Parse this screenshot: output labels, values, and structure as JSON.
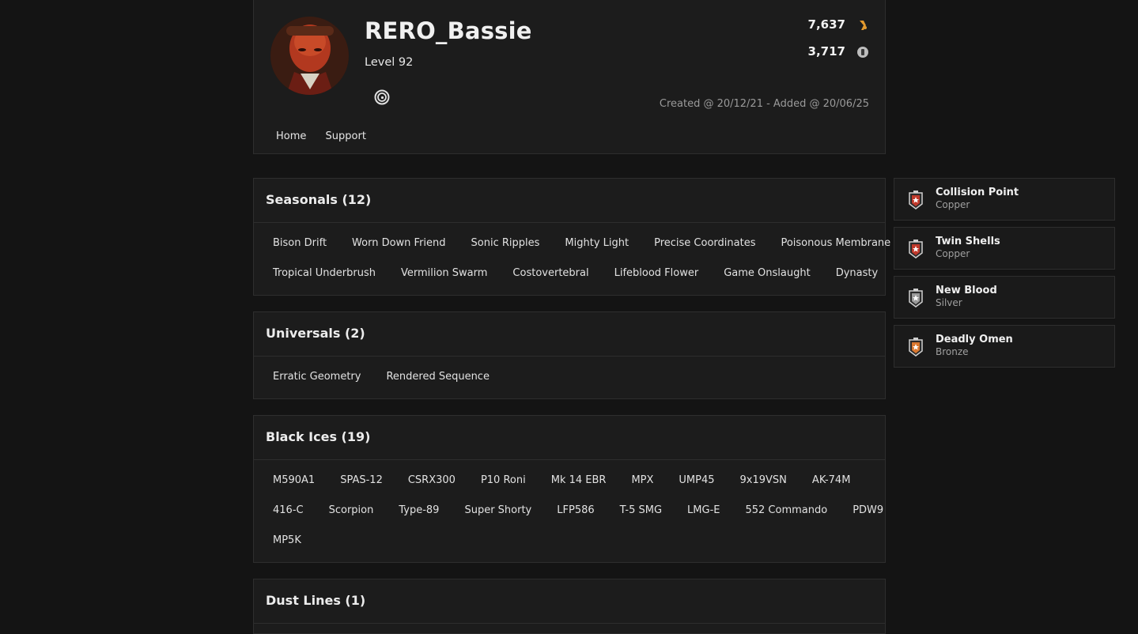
{
  "profile": {
    "username": "RERO_Bassie",
    "level": "Level 92",
    "stat1": "7,637",
    "stat2": "3,717",
    "dates": "Created @ 20/12/21 - Added @ 20/06/25",
    "nav": [
      "Home",
      "Support"
    ]
  },
  "sections": {
    "seasonals": {
      "title": "Seasonals (12)",
      "row1": [
        "Bison Drift",
        "Worn Down Friend",
        "Sonic Ripples",
        "Mighty Light",
        "Precise Coordinates",
        "Poisonous Membrane"
      ],
      "row2": [
        "Tropical Underbrush",
        "Vermilion Swarm",
        "Costovertebral",
        "Lifeblood Flower",
        "Game Onslaught",
        "Dynasty"
      ]
    },
    "universals": {
      "title": "Universals (2)",
      "row1": [
        "Erratic Geometry",
        "Rendered Sequence"
      ]
    },
    "blackices": {
      "title": "Black Ices (19)",
      "row1": [
        "M590A1",
        "SPAS-12",
        "CSRX300",
        "P10 Roni",
        "Mk 14 EBR",
        "MPX",
        "UMP45",
        "9x19VSN",
        "AK-74M"
      ],
      "row2": [
        "416-C",
        "Scorpion",
        "Type-89",
        "Super Shorty",
        "LFP586",
        "T-5 SMG",
        "LMG-E",
        "552 Commando",
        "PDW9"
      ],
      "row3": [
        "MP5K"
      ]
    },
    "dustlines": {
      "title": "Dust Lines (1)"
    }
  },
  "cards": [
    {
      "name": "Collision Point",
      "tier": "Copper",
      "color": "#c0392b"
    },
    {
      "name": "Twin Shells",
      "tier": "Copper",
      "color": "#c0392b"
    },
    {
      "name": "New Blood",
      "tier": "Silver",
      "color": "#9a9a9a"
    },
    {
      "name": "Deadly Omen",
      "tier": "Bronze",
      "color": "#d9772f"
    }
  ],
  "icons": {
    "stat1": "renown-icon",
    "stat2": "credits-icon",
    "platform": "ubisoft-icon",
    "card": "rank-badge-icon"
  }
}
